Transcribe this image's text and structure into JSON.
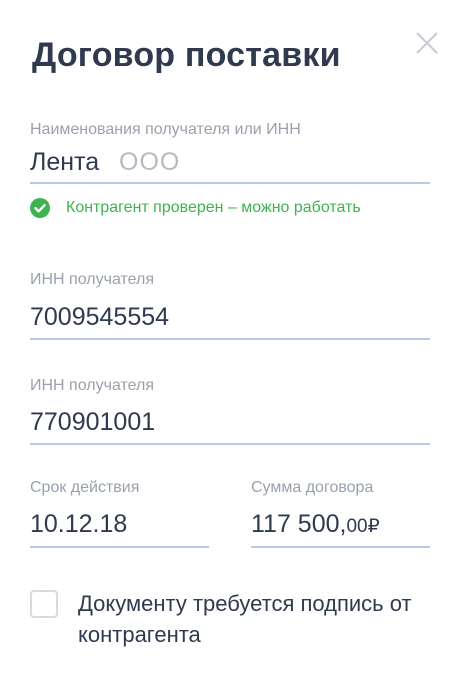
{
  "dialog": {
    "title": "Договор поставки",
    "close_icon": "close-icon"
  },
  "recipient": {
    "label": "Наименования получателя или ИНН",
    "name": "Лента",
    "suffix": "ООО",
    "status_icon": "check-circle-icon",
    "status_text": "Контрагент проверен – можно работать",
    "status_color": "#3fb34f"
  },
  "inn1": {
    "label": "ИНН получателя",
    "value": "7009545554"
  },
  "inn2": {
    "label": "ИНН получателя",
    "value": "770901001"
  },
  "term": {
    "label": "Срок действия",
    "value": "10.12.18"
  },
  "amount": {
    "label": "Сумма договора",
    "value": "117 500,",
    "cents": "00",
    "currency": "₽"
  },
  "signature": {
    "label": "Документу требуется подпись от контрагента",
    "checked": false
  },
  "colors": {
    "accent_line": "#b7c8ef",
    "text": "#2f3a4f",
    "muted": "#9aa1ad"
  }
}
